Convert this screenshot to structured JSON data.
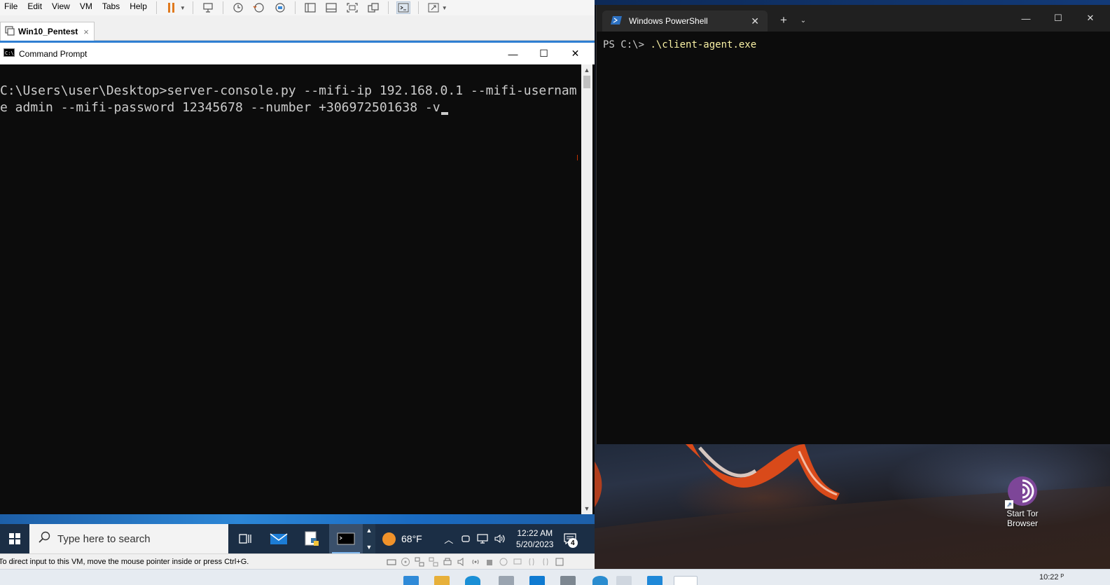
{
  "vmware": {
    "menu": [
      "File",
      "Edit",
      "View",
      "VM",
      "Tabs",
      "Help"
    ],
    "toolbar_icons": [
      "pause-icon",
      "send-keys-icon",
      "snapshot-icon",
      "revert-snapshot-icon",
      "snapshot-manager-icon",
      "show-library-icon",
      "thumbnail-bar-icon",
      "full-screen-icon",
      "unity-icon",
      "console-view-icon",
      "stretch-guest-icon"
    ],
    "tab": {
      "label": "Win10_Pentest",
      "close": "×"
    },
    "status_text": "To direct input to this VM, move the mouse pointer inside or press Ctrl+G."
  },
  "cmd": {
    "title": "Command Prompt",
    "lines": [
      "C:\\Users\\user\\Desktop>server-console.py --mifi-ip 192.168.0.1 --mifi-usernam",
      "e admin --mifi-password 12345678 --number +306972501638 -v"
    ],
    "controls": {
      "minimize": "—",
      "maximize": "☐",
      "close": "✕"
    }
  },
  "guest_taskbar": {
    "search_placeholder": "Type here to search",
    "weather": "68°F",
    "time": "12:22 AM",
    "date": "5/20/2023",
    "notification_count": "4"
  },
  "powershell": {
    "tab_title": "Windows PowerShell",
    "prompt": "PS C:\\> ",
    "command": ".\\client-agent.exe",
    "controls": {
      "new_tab": "+",
      "dropdown": "⌄",
      "minimize": "—",
      "maximize": "☐",
      "close": "✕"
    }
  },
  "desktop": {
    "tor_label_line1": "Start Tor",
    "tor_label_line2": "Browser"
  },
  "host_taskbar": {
    "clock_peek": "10:22 ᴾ"
  },
  "colors": {
    "vmware_accent": "#2f7fd2",
    "terminal_bg": "#0c0c0c",
    "terminal_text": "#cccccc",
    "ps_command": "#f9f1a5",
    "guest_taskbar": "#1b2e45",
    "tor_purple": "#7d4698"
  }
}
